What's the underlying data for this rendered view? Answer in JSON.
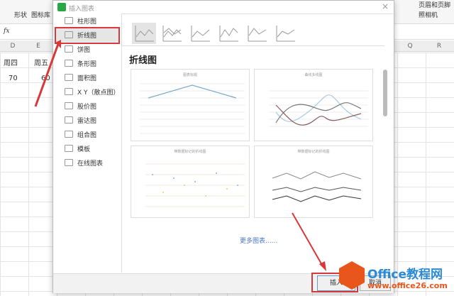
{
  "ribbon": {
    "items": [
      "形状",
      "图标库",
      "页眉和页脚",
      "照相机"
    ]
  },
  "formula_bar": {
    "fx": "fx"
  },
  "sheet": {
    "columns": [
      "D",
      "E",
      "Q",
      "R"
    ],
    "headers": [
      "周四",
      "周五"
    ],
    "values": [
      "70",
      "60"
    ]
  },
  "dialog": {
    "title": "插入图表",
    "close": "×",
    "nav": [
      {
        "label": "柱形图"
      },
      {
        "label": "折线图",
        "selected": true
      },
      {
        "label": "饼图"
      },
      {
        "label": "条形图"
      },
      {
        "label": "面积图"
      },
      {
        "label": "X Y（散点图）"
      },
      {
        "label": "股价图"
      },
      {
        "label": "雷达图"
      },
      {
        "label": "组合图"
      },
      {
        "label": "模板"
      },
      {
        "label": "在线图表"
      }
    ],
    "section_title": "折线图",
    "previews": [
      {
        "title": "图表标题"
      },
      {
        "title": "曲线多线图"
      },
      {
        "title": "带数据标记的折线图"
      },
      {
        "title": "带数据标记的折线图"
      }
    ],
    "more_link": "更多图表......",
    "insert": "插入",
    "cancel": "取消"
  },
  "watermark": {
    "brand": "Office教程网",
    "url": "www.office26.com"
  },
  "colors": {
    "accent_red": "#d9383a",
    "link": "#4a78c2",
    "brand_orange": "#e8561c"
  }
}
